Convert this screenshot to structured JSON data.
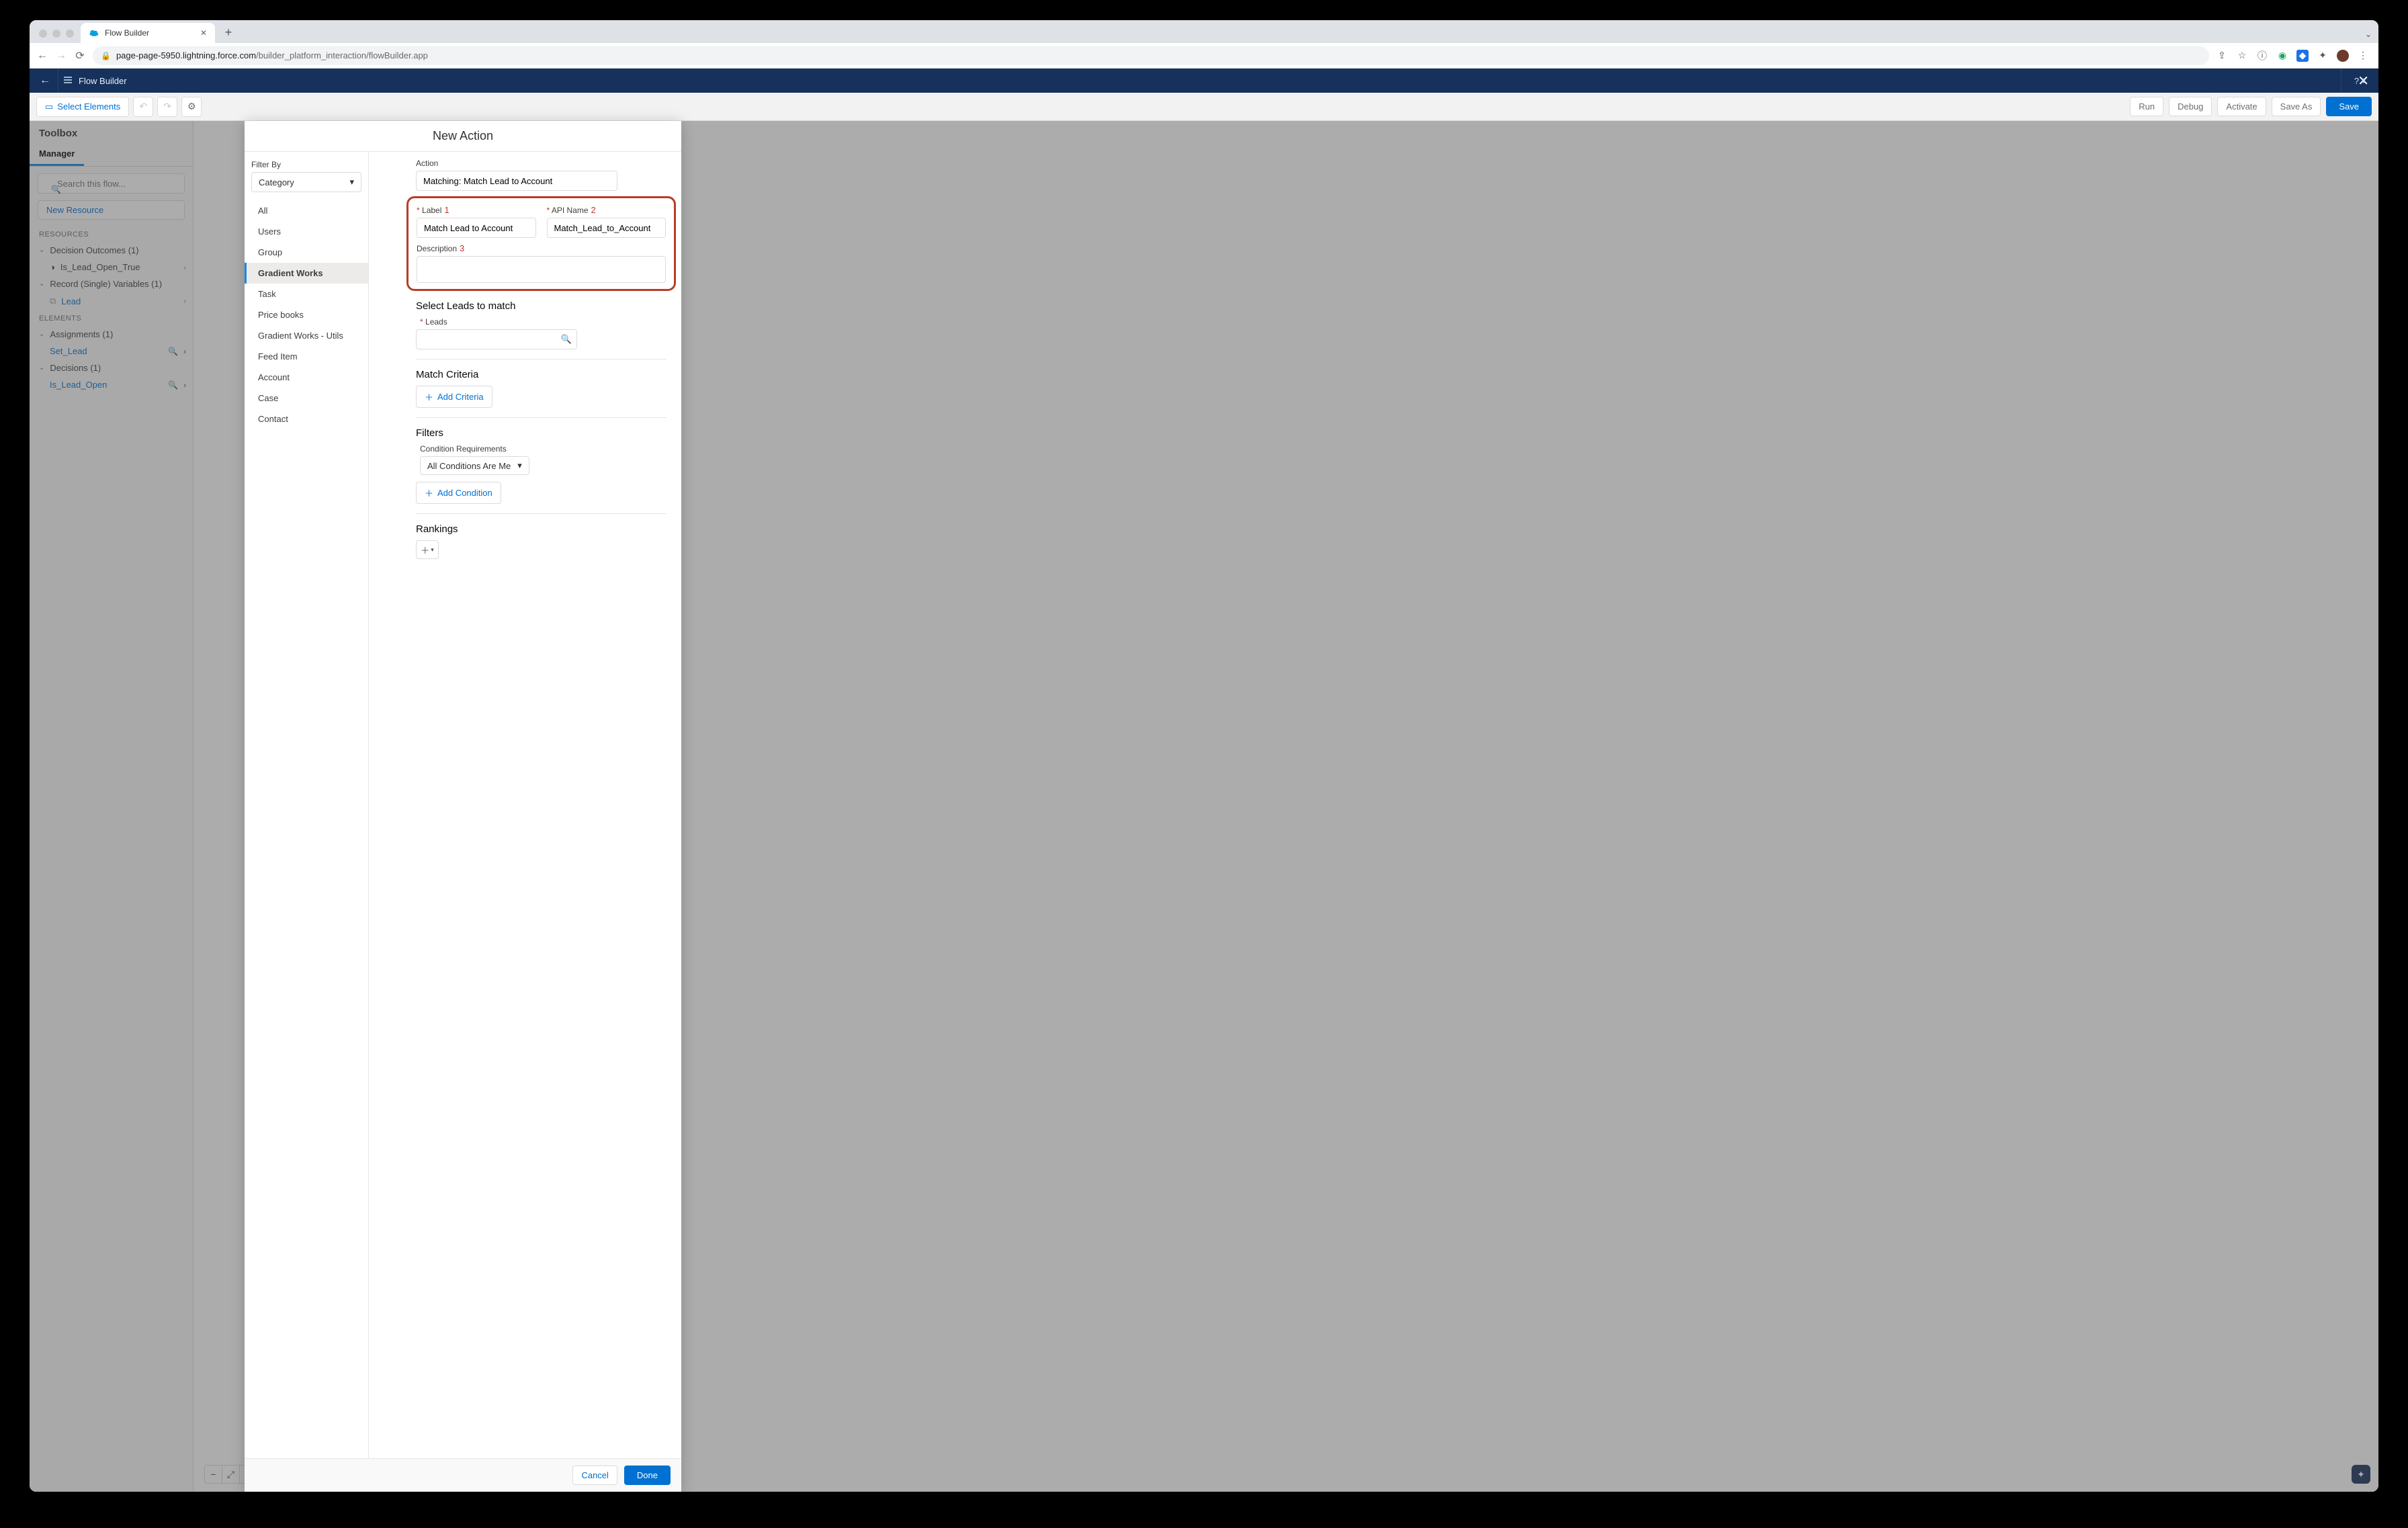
{
  "browser": {
    "tab_title": "Flow Builder",
    "url_host": "page-page-5950.lightning.force.com",
    "url_path": "/builder_platform_interaction/flowBuilder.app"
  },
  "header": {
    "app_title": "Flow Builder",
    "help_label": "?"
  },
  "toolbar": {
    "select_elements": "Select Elements",
    "run": "Run",
    "debug": "Debug",
    "activate": "Activate",
    "save_as": "Save As",
    "save": "Save"
  },
  "sidebar": {
    "title": "Toolbox",
    "tab": "Manager",
    "search_placeholder": "Search this flow...",
    "new_resource": "New Resource",
    "resources_label": "RESOURCES",
    "elements_label": "ELEMENTS",
    "decision_outcomes": "Decision Outcomes (1)",
    "decision_outcomes_leaf": "Is_Lead_Open_True",
    "record_vars": "Record (Single) Variables (1)",
    "record_vars_leaf": "Lead",
    "assignments": "Assignments (1)",
    "assignments_leaf": "Set_Lead",
    "decisions": "Decisions (1)",
    "decisions_leaf": "Is_Lead_Open"
  },
  "modal": {
    "title": "New Action",
    "filter_by": "Filter By",
    "category": "Category",
    "categories": [
      "All",
      "Users",
      "Group",
      "Gradient Works",
      "Task",
      "Price books",
      "Gradient Works - Utils",
      "Feed Item",
      "Account",
      "Case",
      "Contact"
    ],
    "action_label": "Action",
    "action_value": "Matching: Match Lead to Account",
    "label_label": "Label",
    "label_value": "Match Lead to Account",
    "api_name_label": "API Name",
    "api_name_value": "Match_Lead_to_Account",
    "description_label": "Description",
    "annot_1": "1",
    "annot_2": "2",
    "annot_3": "3",
    "sec_leads": "Select Leads to match",
    "leads_label": "Leads",
    "sec_match_criteria": "Match Criteria",
    "add_criteria": "Add Criteria",
    "sec_filters": "Filters",
    "cond_req": "Condition Requirements",
    "cond_value": "All Conditions Are Me",
    "add_condition": "Add Condition",
    "sec_rankings": "Rankings",
    "cancel": "Cancel",
    "done": "Done"
  }
}
